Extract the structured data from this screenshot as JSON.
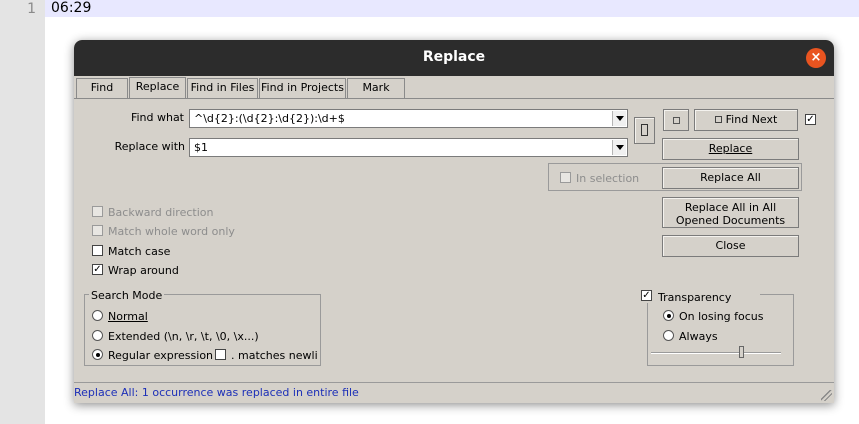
{
  "editor": {
    "line_number": "1",
    "line_text": "06:29"
  },
  "dialog": {
    "title": "Replace",
    "tabs": [
      {
        "label": "Find"
      },
      {
        "label": "Replace"
      },
      {
        "label": "Find in Files"
      },
      {
        "label": "Find in Projects"
      },
      {
        "label": "Mark"
      }
    ],
    "find_what_label": "Find what",
    "find_what_value": "^\\d{2}:(\\d{2}:\\d{2}):\\d+$",
    "replace_with_label": "Replace with",
    "replace_with_value": "$1",
    "buttons": {
      "find_next": "Find Next",
      "replace": "Replace",
      "replace_all": "Replace All",
      "replace_all_opened_line1": "Replace All in All",
      "replace_all_opened_line2": "Opened Documents",
      "close": "Close"
    },
    "in_selection_label": "In selection",
    "options": {
      "backward_direction": {
        "label": "Backward direction",
        "checked": false,
        "enabled": false
      },
      "match_whole_word": {
        "label": "Match whole word only",
        "checked": false,
        "enabled": false
      },
      "match_case": {
        "label": "Match case",
        "checked": false,
        "enabled": true
      },
      "wrap_around": {
        "label": "Wrap around",
        "checked": true,
        "enabled": true
      }
    },
    "search_mode": {
      "title": "Search Mode",
      "normal": "Normal",
      "extended": "Extended (\\n, \\r, \\t, \\0, \\x...)",
      "regex": "Regular expression",
      "matches_newline": ". matches newline",
      "selected": "regex"
    },
    "transparency": {
      "label": "Transparency",
      "checked": true,
      "on_losing_focus": "On losing focus",
      "always": "Always",
      "selected": "on_losing_focus",
      "level": 0.7
    },
    "status": "Replace All: 1 occurrence was replaced in entire file"
  }
}
